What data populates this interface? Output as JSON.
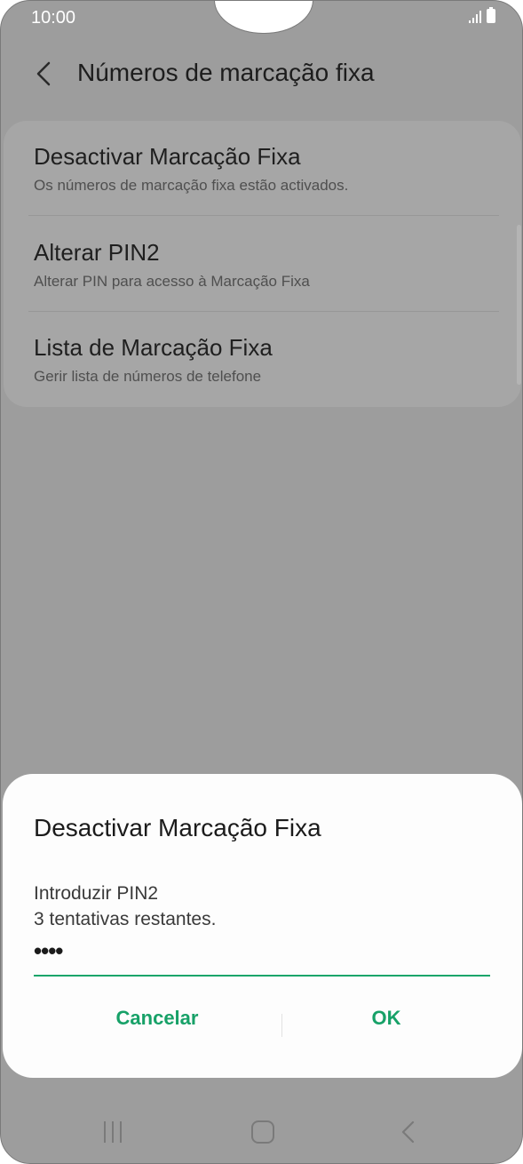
{
  "status_bar": {
    "time": "10:00"
  },
  "header": {
    "title": "Números de marcação fixa"
  },
  "settings": {
    "items": [
      {
        "title": "Desactivar Marcação Fixa",
        "subtitle": "Os números de marcação fixa estão activados."
      },
      {
        "title": "Alterar PIN2",
        "subtitle": "Alterar PIN para acesso à Marcação Fixa"
      },
      {
        "title": "Lista de Marcação Fixa",
        "subtitle": "Gerir lista de números de telefone"
      }
    ]
  },
  "dialog": {
    "title": "Desactivar Marcação Fixa",
    "prompt": "Introduzir PIN2",
    "attempts": "3 tentativas restantes.",
    "pin_value": "••••",
    "cancel_label": "Cancelar",
    "ok_label": "OK",
    "accent_color": "#17a168"
  },
  "colors": {
    "scrim": "#9d9d9d",
    "dialog_bg": "#fdfdfd"
  }
}
